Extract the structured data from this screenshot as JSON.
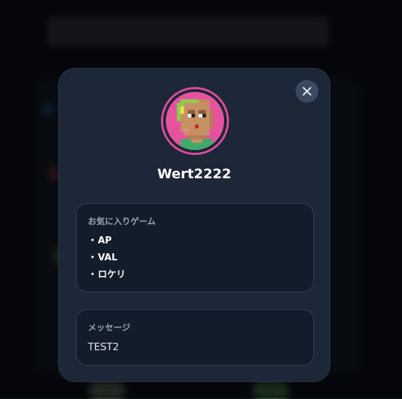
{
  "profile": {
    "username": "Wert2222",
    "accent_color": "#e04c9c",
    "avatar_icon": "pixel-art-avatar"
  },
  "favorite_games": {
    "title": "お気に入りゲーム",
    "bullet": "・",
    "items": [
      "AP",
      "VAL",
      "ロケリ"
    ]
  },
  "message": {
    "title": "メッセージ",
    "text": "TEST2"
  },
  "close_icon": "close-icon"
}
